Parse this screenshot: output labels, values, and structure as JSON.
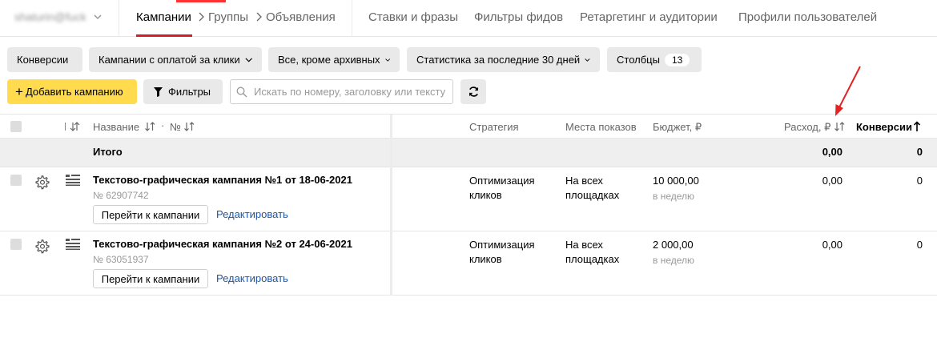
{
  "header": {
    "account": "shaturin@fuck",
    "tab_active": "Кампании",
    "crumbs": [
      "Группы",
      "Объявления"
    ],
    "nav": [
      "Ставки и фразы",
      "Фильтры фидов",
      "Ретаргетинг и аудитории",
      "Профили пользователей"
    ]
  },
  "toolbar": {
    "conversions": "Конверсии",
    "payment_type": "Кампании с оплатой за клики",
    "archive_filter": "Все, кроме архивных",
    "stats_period": "Статистика за последние 30 дней",
    "columns_label": "Столбцы",
    "columns_count": "13",
    "add_campaign": "Добавить кампанию",
    "filters": "Фильтры",
    "search_placeholder": "Искать по номеру, заголовку или тексту"
  },
  "table": {
    "headers": {
      "name": "Название",
      "number": "№",
      "strategy": "Стратегия",
      "placements": "Места показов",
      "budget": "Бюджет, ₽",
      "expense": "Расход, ₽",
      "conversions": "Конверсии"
    },
    "total": {
      "label": "Итого",
      "expense": "0,00",
      "conversions": "0"
    },
    "rows": [
      {
        "title": "Текстово-графическая кампания №1 от 18-06-2021",
        "id": "№ 62907742",
        "goto": "Перейти к кампании",
        "edit": "Редактировать",
        "strategy_line1": "Оптимизация",
        "strategy_line2": "кликов",
        "place_line1": "На всех",
        "place_line2": "площадках",
        "budget": "10 000,00",
        "budget_period": "в неделю",
        "expense": "0,00",
        "conversions": "0"
      },
      {
        "title": "Текстово-графическая кампания №2 от 24-06-2021",
        "id": "№ 63051937",
        "goto": "Перейти к кампании",
        "edit": "Редактировать",
        "strategy_line1": "Оптимизация",
        "strategy_line2": "кликов",
        "place_line1": "На всех",
        "place_line2": "площадках",
        "budget": "2 000,00",
        "budget_period": "в неделю",
        "expense": "0,00",
        "conversions": "0"
      }
    ]
  },
  "colors": {
    "accent_yellow": "#ffdb4d",
    "tab_underline": "#d31f26",
    "link": "#1a56a8",
    "annotation_arrow": "#e32222"
  }
}
